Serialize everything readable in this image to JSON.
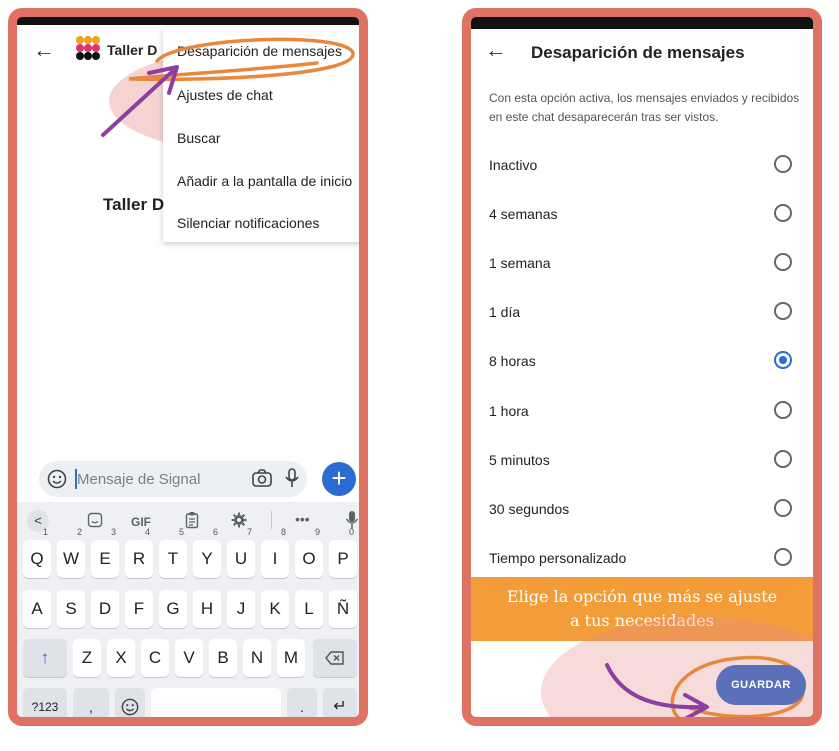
{
  "left_screen": {
    "header": {
      "back_icon": "arrow-left-icon",
      "chat_name": "Taller D"
    },
    "overflow_menu": {
      "items": [
        "Desaparición de mensajes",
        "Ajustes de chat",
        "Buscar",
        "Añadir a la pantalla de inicio",
        "Silenciar notificaciones"
      ]
    },
    "conversation_title": "Taller D",
    "compose": {
      "placeholder": "Mensaje de Signal"
    },
    "keyboard": {
      "toolbar": [
        "<",
        "GIF"
      ],
      "row1": [
        "Q",
        "W",
        "E",
        "R",
        "T",
        "Y",
        "U",
        "I",
        "O",
        "P"
      ],
      "row1_hints": [
        "1",
        "2",
        "3",
        "4",
        "5",
        "6",
        "7",
        "8",
        "9",
        "0"
      ],
      "row2": [
        "A",
        "S",
        "D",
        "F",
        "G",
        "H",
        "J",
        "K",
        "L",
        "Ñ"
      ],
      "row3": [
        "Z",
        "X",
        "C",
        "V",
        "B",
        "N",
        "M"
      ],
      "numbers_key": "?123",
      "comma_key": ",",
      "period_key": "."
    }
  },
  "right_screen": {
    "header": {
      "back_icon": "arrow-left-icon",
      "title": "Desaparición de mensajes"
    },
    "description": "Con esta opción activa, los mensajes enviados y recibidos en este chat desaparecerán tras ser vistos.",
    "options": [
      {
        "label": "Inactivo",
        "selected": false
      },
      {
        "label": "4 semanas",
        "selected": false
      },
      {
        "label": "1 semana",
        "selected": false
      },
      {
        "label": "1 día",
        "selected": false
      },
      {
        "label": "8 horas",
        "selected": true
      },
      {
        "label": "1 hora",
        "selected": false
      },
      {
        "label": "5 minutos",
        "selected": false
      },
      {
        "label": "30 segundos",
        "selected": false
      },
      {
        "label": "Tiempo personalizado",
        "selected": false
      }
    ],
    "annotation_banner": [
      "Elige la opción que más se ajuste",
      "a tus necesidades"
    ],
    "save_button": "GUARDAR"
  },
  "colors": {
    "frame": "#e07263",
    "accent": "#2c6bd2",
    "save": "#5b70b8",
    "banner": "#f29d3a",
    "annotation_orange": "#e8883c",
    "annotation_purple": "#8c3fa0"
  }
}
